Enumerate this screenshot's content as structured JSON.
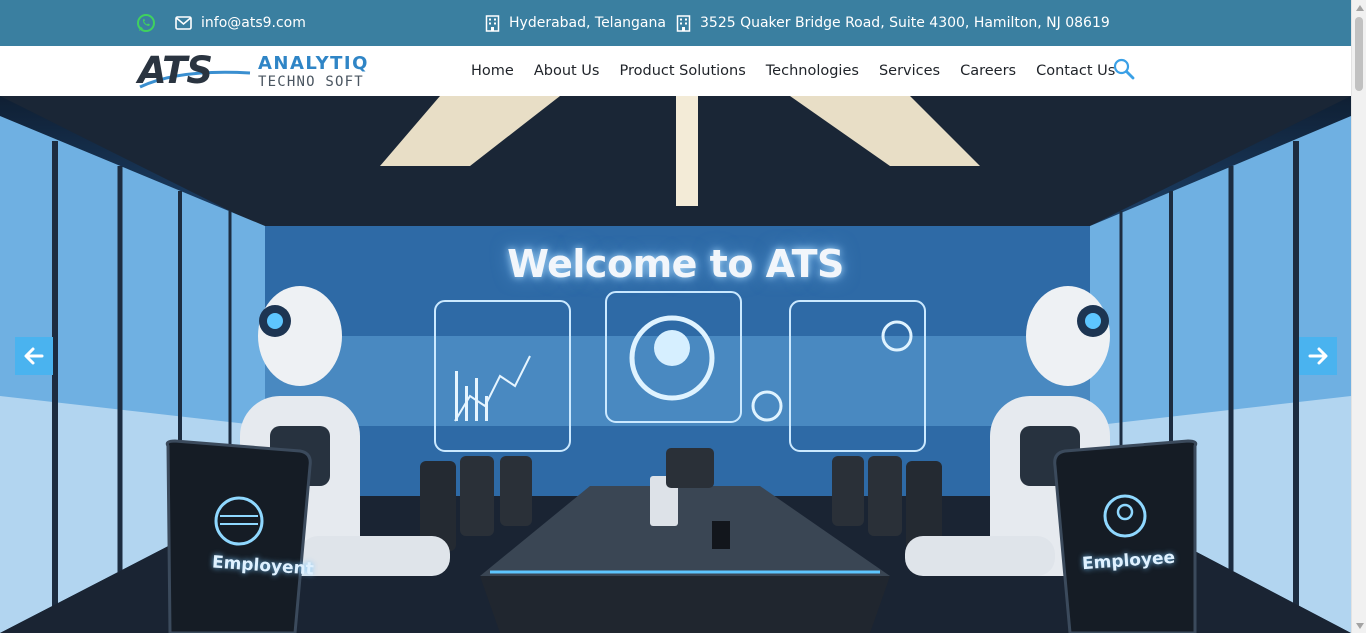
{
  "topbar": {
    "email": "info@ats9.com",
    "location_india": "Hyderabad, Telangana",
    "location_us": "3525 Quaker Bridge Road, Suite 4300, Hamilton, NJ 08619",
    "icons": [
      "whatsapp-icon",
      "mail-icon",
      "building-icon",
      "building-icon"
    ],
    "background_color": "#3a7fa0"
  },
  "logo": {
    "mark": "ATS",
    "line1": "ANALYTIQ",
    "line2": "TECHNO SOFT"
  },
  "nav": {
    "items": [
      {
        "label": "Home"
      },
      {
        "label": "About Us"
      },
      {
        "label": "Product Solutions"
      },
      {
        "label": "Technologies"
      },
      {
        "label": "Services"
      },
      {
        "label": "Careers"
      },
      {
        "label": "Contact Us"
      }
    ],
    "search_icon": "search-icon"
  },
  "hero": {
    "headline": "Welcome to ATS",
    "chair_left_label": "Employent",
    "chair_right_label": "Employee",
    "prev_icon": "arrow-left-icon",
    "next_icon": "arrow-right-icon",
    "accent_color": "#4ab3ef"
  }
}
